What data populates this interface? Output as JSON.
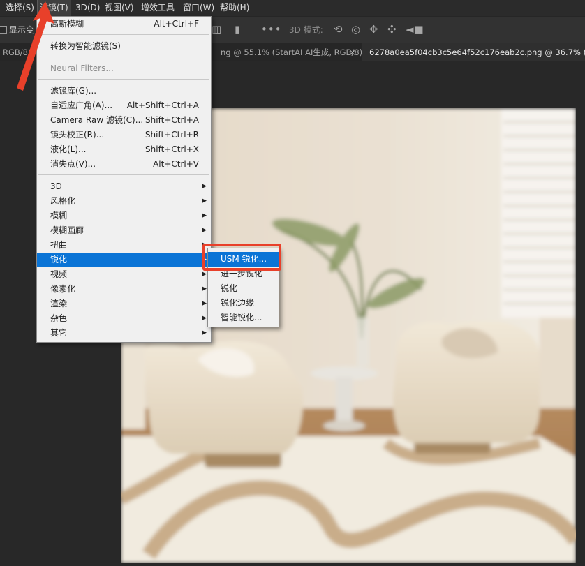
{
  "menubar": {
    "items": [
      {
        "label": "选择(S)"
      },
      {
        "label": "滤镜(T)"
      },
      {
        "label": "3D(D)"
      },
      {
        "label": "视图(V)"
      },
      {
        "label": "增效工具"
      },
      {
        "label": "窗口(W)"
      },
      {
        "label": "帮助(H)"
      }
    ]
  },
  "toolbar": {
    "show_transform_label": "显示变",
    "mode_3d_label": "3D 模式:"
  },
  "tabs": [
    {
      "label": "RGB/8)"
    },
    {
      "label": "ng @ 55.1% (StartAI AI生成, RGB/8) *"
    },
    {
      "label": "6278a0ea5f04cb3c5e64f52c176eab2c.png @ 36.7% (图层 1"
    }
  ],
  "tab_close_glyph": "×",
  "filter_menu": {
    "groups": [
      [
        {
          "label": "高斯模糊",
          "shortcut": "Alt+Ctrl+F"
        }
      ],
      [
        {
          "label": "转换为智能滤镜(S)",
          "shortcut": ""
        }
      ],
      [
        {
          "label": "Neural Filters...",
          "shortcut": ""
        }
      ],
      [
        {
          "label": "滤镜库(G)...",
          "shortcut": ""
        },
        {
          "label": "自适应广角(A)...",
          "shortcut": "Alt+Shift+Ctrl+A"
        },
        {
          "label": "Camera Raw 滤镜(C)...",
          "shortcut": "Shift+Ctrl+A"
        },
        {
          "label": "镜头校正(R)...",
          "shortcut": "Shift+Ctrl+R"
        },
        {
          "label": "液化(L)...",
          "shortcut": "Shift+Ctrl+X"
        },
        {
          "label": "消失点(V)...",
          "shortcut": "Alt+Ctrl+V"
        }
      ],
      [
        {
          "label": "3D"
        },
        {
          "label": "风格化"
        },
        {
          "label": "模糊"
        },
        {
          "label": "模糊画廊"
        },
        {
          "label": "扭曲"
        },
        {
          "label": "锐化"
        },
        {
          "label": "视频"
        },
        {
          "label": "像素化"
        },
        {
          "label": "渲染"
        },
        {
          "label": "杂色"
        },
        {
          "label": "其它"
        }
      ]
    ]
  },
  "sharpen_submenu": {
    "items": [
      {
        "label": "USM 锐化..."
      },
      {
        "label": "进一步锐化"
      },
      {
        "label": "锐化"
      },
      {
        "label": "锐化边缘"
      },
      {
        "label": "智能锐化..."
      }
    ]
  },
  "colors": {
    "highlight": "#0a74d6",
    "annotation_red": "#e8402a",
    "app_bg": "#282828"
  }
}
